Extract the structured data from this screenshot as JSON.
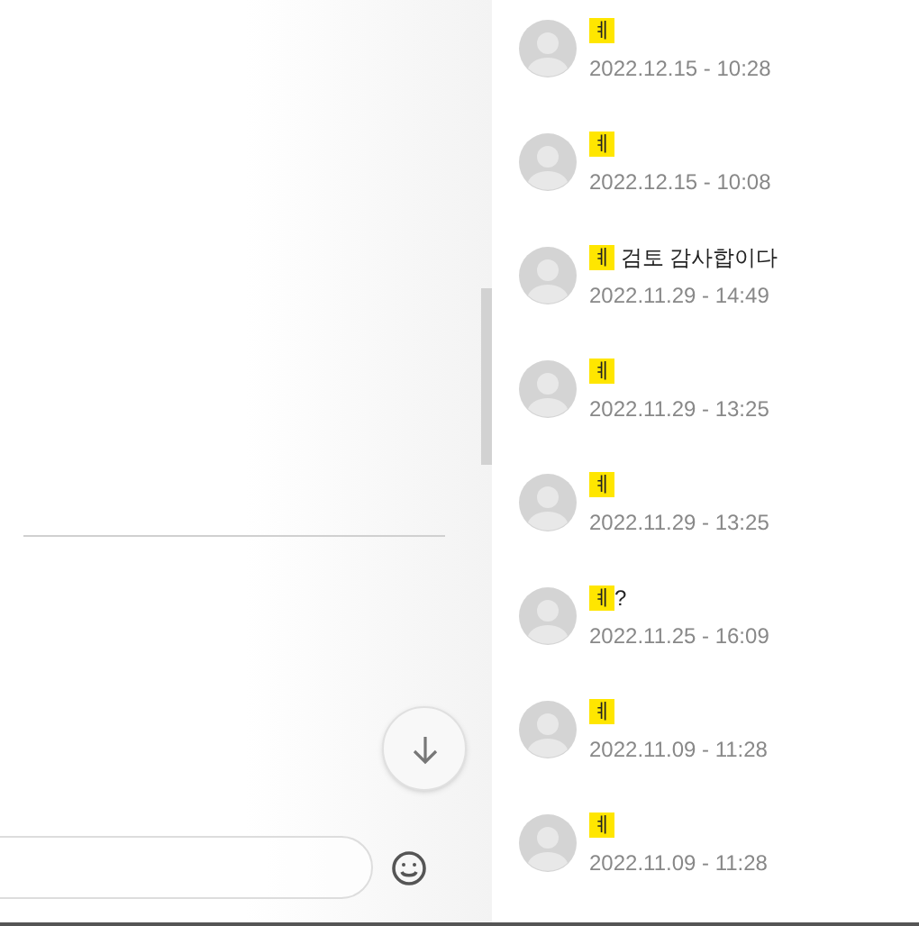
{
  "results": [
    {
      "match": "ㅖ",
      "time": "2022.12.15 - 10:28"
    },
    {
      "match": "ㅖ",
      "time": "2022.12.15 - 10:08"
    },
    {
      "match": "ㅖ",
      "rest": " 검토 감사합이다",
      "time": "2022.11.29 - 14:49"
    },
    {
      "match": "ㅖ",
      "time": "2022.11.29 - 13:25"
    },
    {
      "match": "ㅖ",
      "time": "2022.11.29 - 13:25"
    },
    {
      "match": "ㅖ",
      "rest": "?",
      "time": "2022.11.25 - 16:09"
    },
    {
      "match": "ㅖ",
      "time": "2022.11.09 - 11:28"
    },
    {
      "match": "ㅖ",
      "time": "2022.11.09 - 11:28"
    }
  ]
}
